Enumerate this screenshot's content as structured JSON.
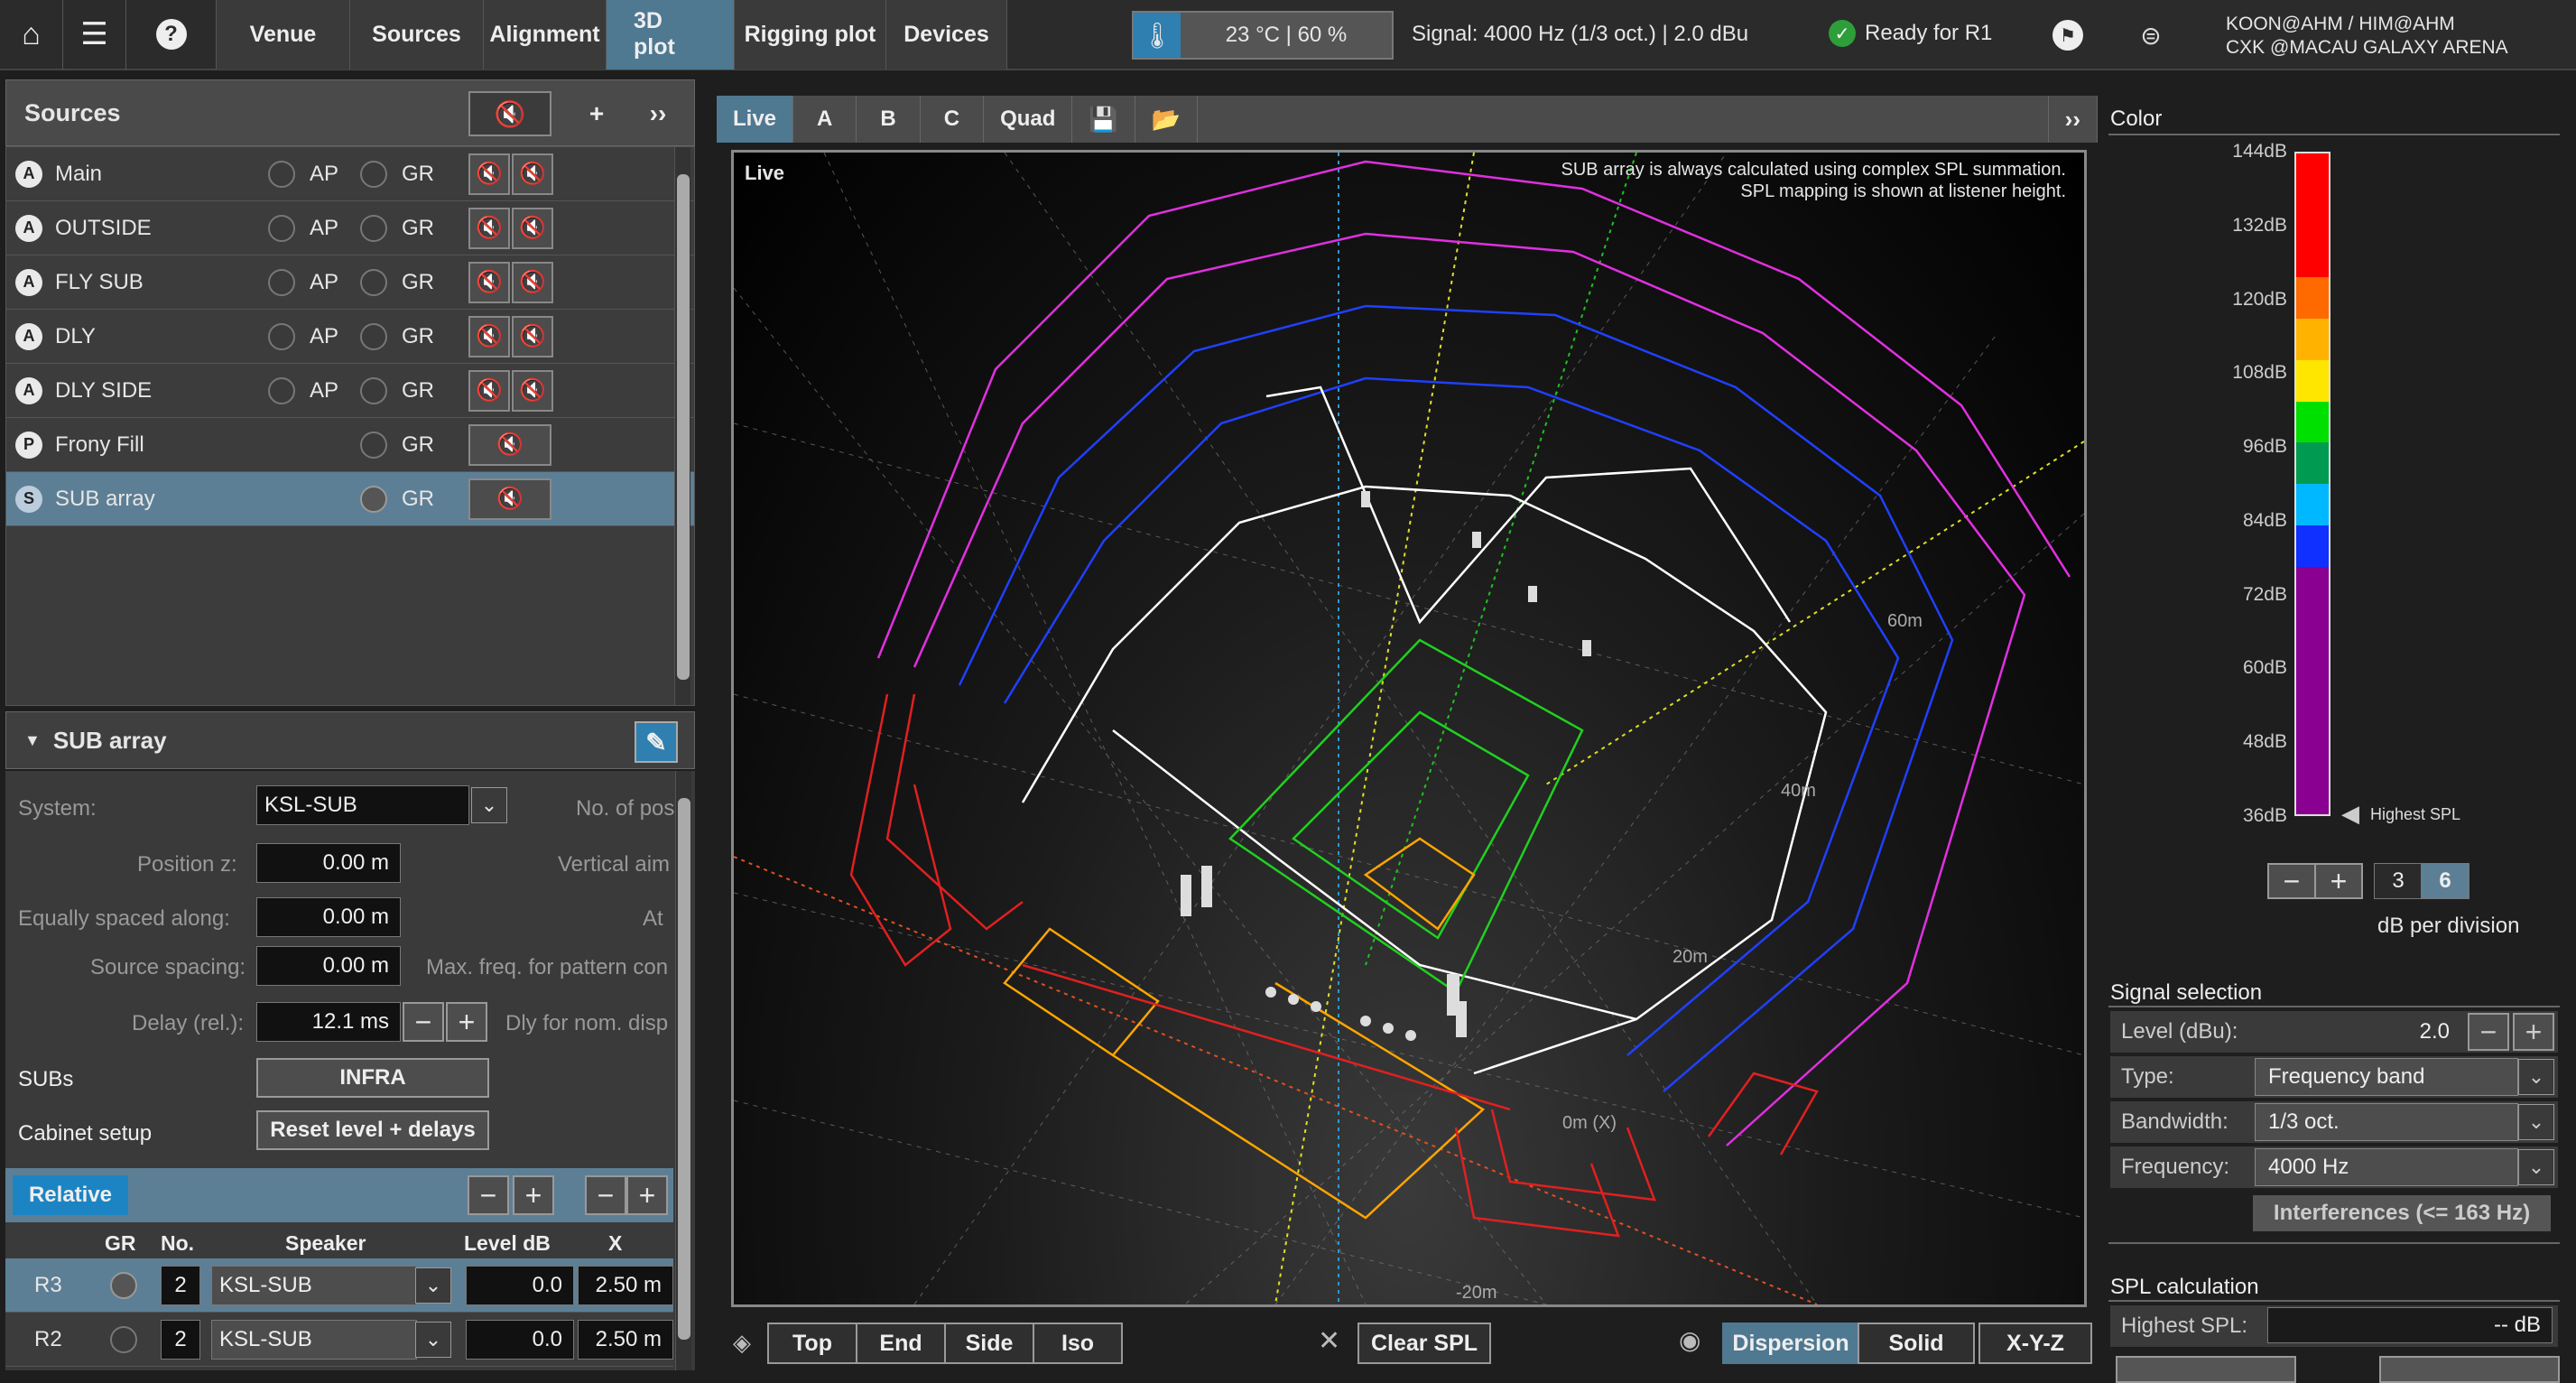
{
  "topbar": {
    "tabs": [
      "Venue",
      "Sources",
      "Alignment",
      "3D plot",
      "Rigging plot",
      "Devices"
    ],
    "temperature": "23 °C | 60 %",
    "signal": "Signal: 4000 Hz (1/3 oct.) | 2.0 dBu",
    "ready": "Ready for R1",
    "user_line1": "KOON@AHM / HIM@AHM",
    "user_line2": "CXK @MACAU GALAXY ARENA"
  },
  "sources_panel": {
    "title": "Sources",
    "rows": [
      {
        "badge": "A",
        "name": "Main",
        "ap": "AP",
        "gr": "GR"
      },
      {
        "badge": "A",
        "name": "OUTSIDE",
        "ap": "AP",
        "gr": "GR"
      },
      {
        "badge": "A",
        "name": "FLY SUB",
        "ap": "AP",
        "gr": "GR"
      },
      {
        "badge": "A",
        "name": "DLY",
        "ap": "AP",
        "gr": "GR"
      },
      {
        "badge": "A",
        "name": "DLY SIDE",
        "ap": "AP",
        "gr": "GR"
      },
      {
        "badge": "P",
        "name": "Frony Fill",
        "ap": "",
        "gr": "GR"
      },
      {
        "badge": "S",
        "name": "SUB array",
        "ap": "",
        "gr": "GR"
      }
    ]
  },
  "sub_panel": {
    "title": "SUB array",
    "system_label": "System:",
    "system_value": "KSL-SUB",
    "no_of_pos_label": "No. of pos",
    "position_z_label": "Position z:",
    "position_z_value": "0.00 m",
    "vertical_aim_label": "Vertical aim",
    "equally_spaced_label": "Equally spaced along:",
    "equally_spaced_value": "0.00 m",
    "at_label": "At",
    "source_spacing_label": "Source spacing:",
    "source_spacing_value": "0.00 m",
    "max_freq_label": "Max. freq. for pattern con",
    "delay_label": "Delay (rel.):",
    "delay_value": "12.1 ms",
    "dly_nom_label": "Dly for nom. disp",
    "subs_label": "SUBs",
    "subs_button": "INFRA",
    "cabinet_label": "Cabinet setup",
    "reset_button": "Reset level + delays",
    "relative_button": "Relative",
    "table_headers": [
      "GR",
      "No.",
      "Speaker",
      "Level dB",
      "X"
    ],
    "table_rows": [
      {
        "name": "R3",
        "no": "2",
        "speaker": "KSL-SUB",
        "level": "0.0",
        "x": "2.50 m"
      },
      {
        "name": "R2",
        "no": "2",
        "speaker": "KSL-SUB",
        "level": "0.0",
        "x": "2.50 m"
      }
    ]
  },
  "view": {
    "tabs": [
      "Live",
      "A",
      "B",
      "C",
      "Quad"
    ],
    "live_label": "Live",
    "note1": "SUB array is always calculated using complex SPL summation.",
    "note2": "SPL mapping is shown at listener height.",
    "distance_labels": [
      "60m",
      "40m",
      "20m",
      "0m (X)",
      "-20m"
    ],
    "bottom_buttons": [
      "Top",
      "End",
      "Side",
      "Iso"
    ],
    "clear_spl": "Clear SPL",
    "mode_buttons": [
      "Dispersion",
      "Solid",
      "X-Y-Z"
    ]
  },
  "color_panel": {
    "title": "Color",
    "scale": [
      "144dB",
      "132dB",
      "120dB",
      "108dB",
      "96dB",
      "84dB",
      "72dB",
      "60dB",
      "48dB",
      "36dB"
    ],
    "highest_spl_marker": "Highest SPL",
    "division_values": [
      "3",
      "6"
    ],
    "division_label": "dB per division",
    "colors": [
      "#ff0000",
      "#ff0000",
      "#ff0000",
      "#ff6a00",
      "#ffb300",
      "#ffe600",
      "#00e000",
      "#009a50",
      "#00b8ff",
      "#1030ff",
      "#8a0090",
      "#8a0090",
      "#8a0090",
      "#8a0090",
      "#8a0090",
      "#8a0090"
    ]
  },
  "signal_selection": {
    "title": "Signal selection",
    "level_label": "Level (dBu):",
    "level_value": "2.0",
    "type_label": "Type:",
    "type_value": "Frequency band",
    "bandwidth_label": "Bandwidth:",
    "bandwidth_value": "1/3 oct.",
    "frequency_label": "Frequency:",
    "frequency_value": "4000 Hz",
    "interferences_button": "Interferences (<= 163 Hz)"
  },
  "spl_calc": {
    "title": "SPL calculation",
    "highest_label": "Highest SPL:",
    "highest_value": "-- dB"
  }
}
